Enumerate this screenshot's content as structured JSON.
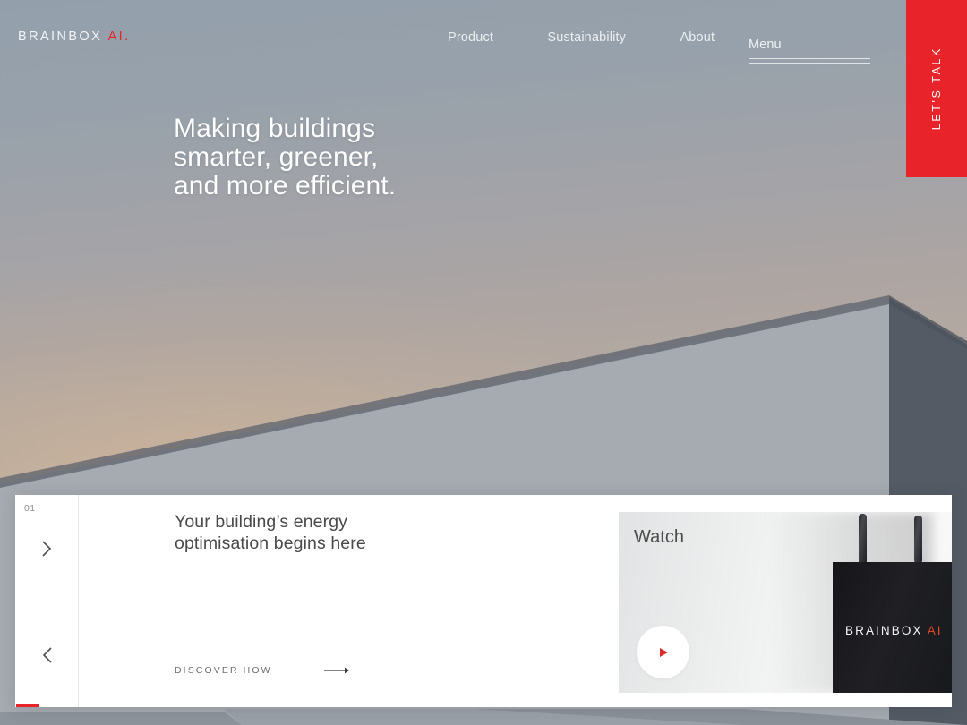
{
  "brand": {
    "name": "BRAINBOX",
    "suffix": "AI.",
    "accent_red": "#e8232a"
  },
  "nav": {
    "items": [
      {
        "label": "Product"
      },
      {
        "label": "Sustainability"
      },
      {
        "label": "About"
      }
    ],
    "menu_label": "Menu",
    "cta_vertical_label": "LET'S TALK"
  },
  "hero": {
    "headline_line1": "Making buildings",
    "headline_line2": "smarter, greener,",
    "headline_line3": "and more efficient."
  },
  "card": {
    "slide_index": "01",
    "next_icon": "chevron-right-icon",
    "prev_icon": "chevron-left-icon",
    "title_line1": "Your building’s energy",
    "title_line2": "optimisation begins here",
    "cta_label": "DISCOVER HOW",
    "cta_arrow_icon": "arrow-right-icon",
    "progress_percent": 13
  },
  "video": {
    "label": "Watch",
    "play_icon": "play-icon",
    "device_brand": "BRAINBOX",
    "device_brand_suffix": "AI",
    "device_accent": "#e24826"
  },
  "colors": {
    "sky_top": "#93a0ab",
    "sky_bottom": "#b6aa9e",
    "building_light": "#a9adb3",
    "building_dark": "#555c66",
    "card_bg": "#ffffff"
  }
}
